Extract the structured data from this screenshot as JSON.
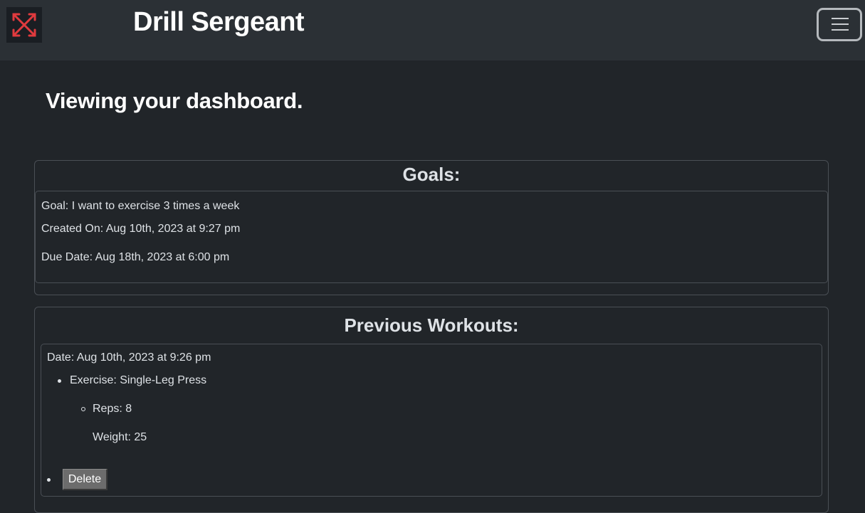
{
  "navbar": {
    "brand": "Drill Sergeant",
    "logo_icon": "crossed-arrows-icon",
    "menu_icon": "hamburger-icon",
    "accent_color": "#e03a3e"
  },
  "page": {
    "heading": "Viewing your dashboard."
  },
  "goals": {
    "title": "Goals:",
    "items": [
      {
        "goal": "Goal: I want to exercise 3 times a week",
        "created": "Created On: Aug 10th, 2023 at 9:27 pm",
        "due": "Due Date: Aug 18th, 2023 at 6:00 pm"
      }
    ]
  },
  "workouts": {
    "title": "Previous Workouts:",
    "items": [
      {
        "date": "Date: Aug 10th, 2023 at 9:26 pm",
        "exercise": "Exercise: Single-Leg Press",
        "reps": "Reps: 8",
        "weight": "Weight: 25",
        "delete_label": "Delete"
      }
    ]
  }
}
